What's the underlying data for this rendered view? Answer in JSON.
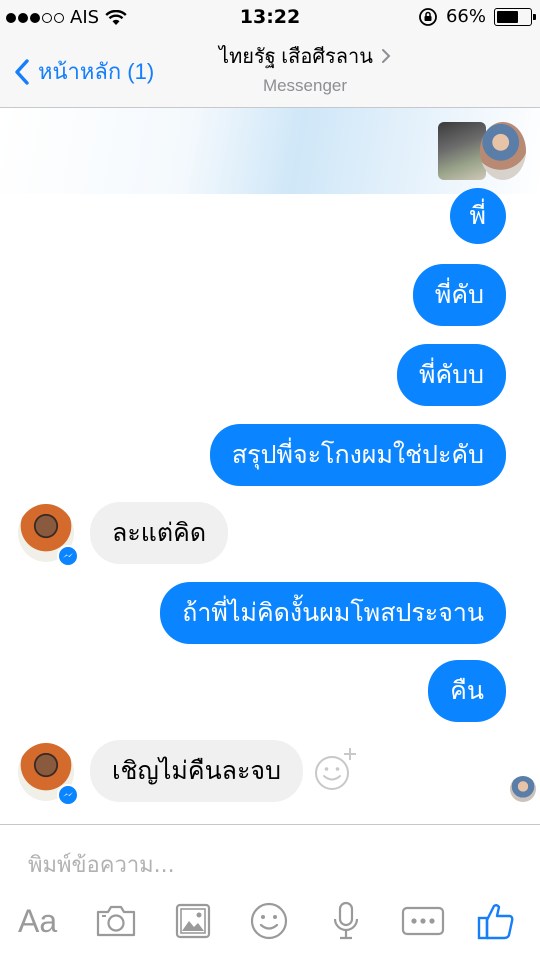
{
  "status_bar": {
    "carrier": "AIS",
    "time": "13:22",
    "battery_text": "66%",
    "battery_level": 0.66,
    "signal_bars": [
      true,
      true,
      true,
      false,
      false
    ]
  },
  "nav": {
    "back_label": "หน้าหลัก (1)",
    "title": "ไทยรัฐ เสือศีรลาน",
    "subtitle": "Messenger",
    "accent_color": "#147efb"
  },
  "messages": [
    {
      "direction": "out",
      "text": "พี่"
    },
    {
      "direction": "out",
      "text": "พี่คับ"
    },
    {
      "direction": "out",
      "text": "พี่คับบ"
    },
    {
      "direction": "out",
      "text": "สรุปพี่จะโกงผมใช่ปะคับ"
    },
    {
      "direction": "in",
      "text": "ละแต่คิด"
    },
    {
      "direction": "out",
      "text": "ถ้าพี่ไม่คิดงั้นผมโพสประจาน"
    },
    {
      "direction": "out",
      "text": "คืน"
    },
    {
      "direction": "in",
      "text": "เชิญไม่คืนละจบ"
    }
  ],
  "colors": {
    "outgoing_bubble": "#0a84ff",
    "incoming_bubble": "#f1f0f0"
  },
  "composer": {
    "placeholder": "พิมพ์ข้อความ...",
    "text_format_label": "Aa",
    "tools": [
      "text-format-icon",
      "camera-icon",
      "gallery-icon",
      "emoji-icon",
      "microphone-icon",
      "more-icon",
      "like-icon"
    ]
  }
}
